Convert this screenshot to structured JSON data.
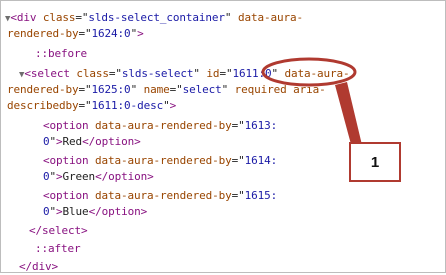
{
  "dom_tree": {
    "lines": [
      {
        "segments": [
          {
            "text": "▼",
            "kind": "tri"
          },
          {
            "text": "<div ",
            "kind": "tag"
          },
          {
            "text": "class",
            "kind": "attr"
          },
          {
            "text": "=\"",
            "kind": "plain"
          },
          {
            "text": "slds-select_container",
            "kind": "val"
          },
          {
            "text": "\" ",
            "kind": "plain"
          },
          {
            "text": "data-aura-",
            "kind": "attr"
          }
        ]
      },
      {
        "segments": [
          {
            "text": "rendered-by",
            "kind": "attr"
          },
          {
            "text": "=\"",
            "kind": "plain"
          },
          {
            "text": "1624:0",
            "kind": "val"
          },
          {
            "text": "\"",
            "kind": "plain"
          },
          {
            "text": ">",
            "kind": "tag"
          }
        ]
      },
      {
        "segments": [
          {
            "text": "::before",
            "kind": "pseudo"
          }
        ]
      },
      {
        "segments": [
          {
            "text": "▼",
            "kind": "tri"
          },
          {
            "text": "<select ",
            "kind": "tag"
          },
          {
            "text": "class",
            "kind": "attr"
          },
          {
            "text": "=\"",
            "kind": "plain"
          },
          {
            "text": "slds-select",
            "kind": "val"
          },
          {
            "text": "\" ",
            "kind": "plain"
          },
          {
            "text": "id",
            "kind": "attr"
          },
          {
            "text": "=\"",
            "kind": "plain"
          },
          {
            "text": "1611:0",
            "kind": "val"
          },
          {
            "text": "\" ",
            "kind": "plain"
          },
          {
            "text": "data-aura-",
            "kind": "attr"
          }
        ]
      },
      {
        "segments": [
          {
            "text": "rendered-by",
            "kind": "attr"
          },
          {
            "text": "=\"",
            "kind": "plain"
          },
          {
            "text": "1625:0",
            "kind": "val"
          },
          {
            "text": "\" ",
            "kind": "plain"
          },
          {
            "text": "name",
            "kind": "attr"
          },
          {
            "text": "=\"",
            "kind": "plain"
          },
          {
            "text": "select",
            "kind": "val"
          },
          {
            "text": "\" ",
            "kind": "plain"
          },
          {
            "text": "required aria-",
            "kind": "attr"
          }
        ]
      },
      {
        "segments": [
          {
            "text": "describedby",
            "kind": "attr"
          },
          {
            "text": "=\"",
            "kind": "plain"
          },
          {
            "text": "1611:0-desc",
            "kind": "val"
          },
          {
            "text": "\"",
            "kind": "plain"
          },
          {
            "text": ">",
            "kind": "tag"
          }
        ]
      },
      {
        "segments": [
          {
            "text": "<option ",
            "kind": "tag"
          },
          {
            "text": "data-aura-rendered-by",
            "kind": "attr"
          },
          {
            "text": "=\"",
            "kind": "plain"
          },
          {
            "text": "1613:",
            "kind": "val"
          }
        ]
      },
      {
        "segments": [
          {
            "text": "0",
            "kind": "val"
          },
          {
            "text": "\"",
            "kind": "plain"
          },
          {
            "text": ">",
            "kind": "tag"
          },
          {
            "text": "Red",
            "kind": "plain"
          },
          {
            "text": "</option>",
            "kind": "tag"
          }
        ]
      },
      {
        "segments": [
          {
            "text": "<option ",
            "kind": "tag"
          },
          {
            "text": "data-aura-rendered-by",
            "kind": "attr"
          },
          {
            "text": "=\"",
            "kind": "plain"
          },
          {
            "text": "1614:",
            "kind": "val"
          }
        ]
      },
      {
        "segments": [
          {
            "text": "0",
            "kind": "val"
          },
          {
            "text": "\"",
            "kind": "plain"
          },
          {
            "text": ">",
            "kind": "tag"
          },
          {
            "text": "Green",
            "kind": "plain"
          },
          {
            "text": "</option>",
            "kind": "tag"
          }
        ]
      },
      {
        "segments": [
          {
            "text": "<option ",
            "kind": "tag"
          },
          {
            "text": "data-aura-rendered-by",
            "kind": "attr"
          },
          {
            "text": "=\"",
            "kind": "plain"
          },
          {
            "text": "1615:",
            "kind": "val"
          }
        ]
      },
      {
        "segments": [
          {
            "text": "0",
            "kind": "val"
          },
          {
            "text": "\"",
            "kind": "plain"
          },
          {
            "text": ">",
            "kind": "tag"
          },
          {
            "text": "Blue",
            "kind": "plain"
          },
          {
            "text": "</option>",
            "kind": "tag"
          }
        ]
      },
      {
        "segments": [
          {
            "text": "</select>",
            "kind": "tag"
          }
        ]
      },
      {
        "segments": [
          {
            "text": "::after",
            "kind": "pseudo"
          }
        ]
      },
      {
        "segments": [
          {
            "text": "</div>",
            "kind": "tag"
          }
        ]
      }
    ]
  },
  "callout": {
    "number": "1",
    "color": "#b03a30"
  },
  "colors": {
    "tag": "#881280",
    "attribute": "#994500",
    "value": "#1a1aa6",
    "text": "#222222"
  }
}
